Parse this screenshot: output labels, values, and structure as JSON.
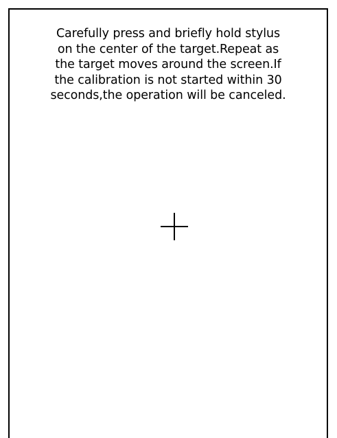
{
  "calibration": {
    "instruction_lines": [
      "Carefully press and briefly hold stylus",
      "on the center of the target.Repeat as",
      "the target moves around the screen.If",
      "the calibration is not started within 30",
      "seconds,the operation will be canceled."
    ],
    "target_icon": "crosshair-target-icon"
  }
}
